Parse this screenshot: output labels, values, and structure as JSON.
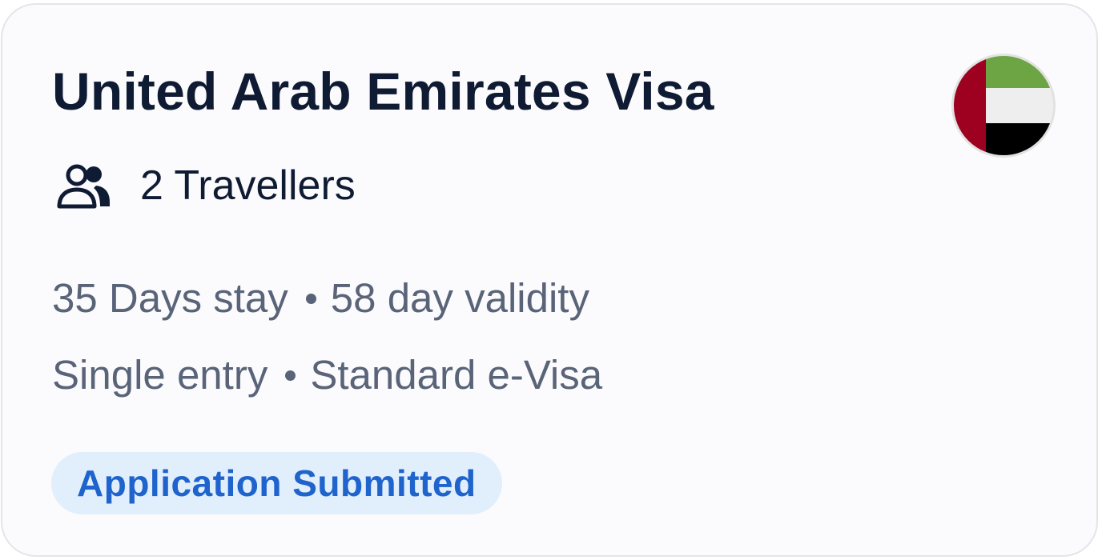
{
  "visa": {
    "title": "United Arab Emirates Visa",
    "travellers_label": "2 Travellers",
    "stay": "35 Days stay",
    "validity": "58 day validity",
    "entry_type": "Single entry",
    "visa_type": "Standard e-Visa",
    "status": "Application Submitted"
  },
  "icons": {
    "travellers": "users-icon",
    "flag": "uae-flag-icon"
  },
  "colors": {
    "title": "#0f1b33",
    "secondary_text": "#5a6478",
    "status_text": "#1f63cc",
    "status_background": "#e1eefc",
    "flag_red": "#9e0020",
    "flag_green": "#6da544",
    "flag_white": "#eeeeee",
    "flag_black": "#000000"
  }
}
